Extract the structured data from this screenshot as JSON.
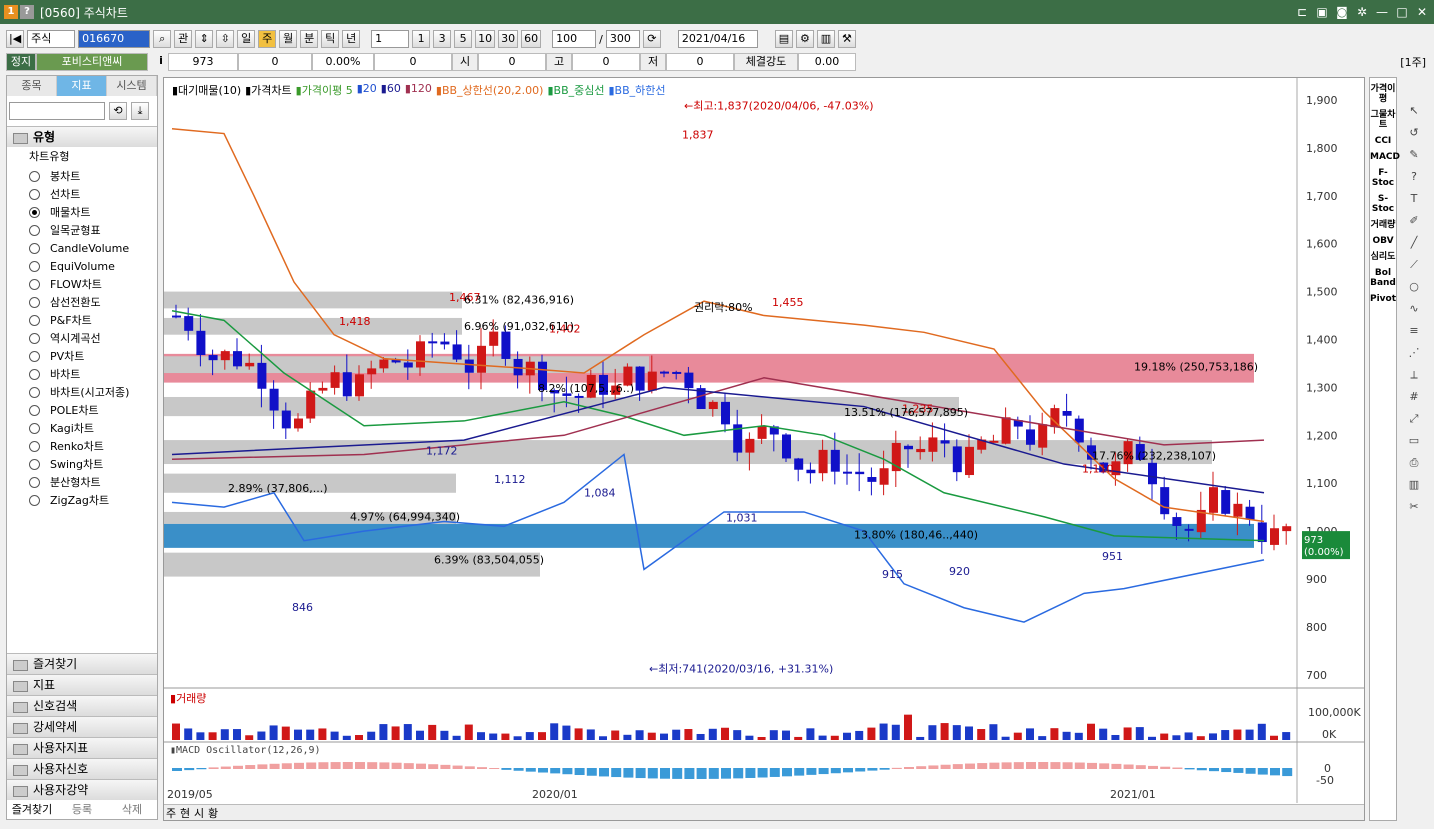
{
  "window": {
    "badge": "1",
    "help": "?",
    "title": "[0560] 주식차트"
  },
  "toolbar": {
    "market": "주식",
    "code": "016670",
    "gwan": "관",
    "periods": [
      "일",
      "주",
      "월",
      "분",
      "틱",
      "년"
    ],
    "period_selected": "주",
    "interval": "1",
    "quick": [
      "1",
      "3",
      "5",
      "10",
      "30",
      "60"
    ],
    "count": "100",
    "total": "300",
    "date": "2021/04/16"
  },
  "quote": {
    "status": "정지",
    "name": "포비스티앤씨",
    "info": "i",
    "price": "973",
    "change": "0",
    "rate": "0.00%",
    "vol": "0",
    "open_l": "시",
    "open": "0",
    "high_l": "고",
    "high": "0",
    "low_l": "저",
    "low": "0",
    "str_l": "체결강도",
    "str": "0.00",
    "unit": "[1주]"
  },
  "left": {
    "tabs": [
      "종목",
      "지표",
      "시스템"
    ],
    "tab_on": "지표",
    "group": "유형",
    "subgroup": "차트유형",
    "types": [
      "봉차트",
      "선차트",
      "매물차트",
      "일목균형표",
      "CandleVolume",
      "EquiVolume",
      "FLOW차트",
      "삼선전환도",
      "P&F차트",
      "역시계곡선",
      "PV차트",
      "바차트",
      "바차트(시고저종)",
      "POLE차트",
      "Kagi차트",
      "Renko차트",
      "Swing차트",
      "분산형차트",
      "ZigZag차트"
    ],
    "selected": "매물차트",
    "groups": [
      "즐겨찾기",
      "지표",
      "신호검색",
      "강세약세",
      "사용자지표",
      "사용자신호",
      "사용자강약"
    ],
    "bottom": [
      "즐겨찾기",
      "등록",
      "삭제"
    ]
  },
  "legend": {
    "items": [
      "대기매물(10)",
      "가격차트",
      "가격이평 5",
      "20",
      "60",
      "120",
      "BB_상한선(20,2.00)",
      "BB_중심선",
      "BB_하한선"
    ],
    "colors": [
      "#000",
      "#000",
      "#3a9a2a",
      "#2050d0",
      "#1a1a90",
      "#a03050",
      "#e06a20",
      "#1a9a40",
      "#2a6ae0"
    ]
  },
  "annotations": {
    "high": "←최고:1,837(2020/04/06, -47.03%)",
    "low": "←최저:741(2020/03/16, +31.31%)",
    "rights": "권리락:80%",
    "price_tag": "973",
    "price_tag2": "(0.00%)",
    "points": [
      "1,837",
      "1,467",
      "1,418",
      "1,402",
      "1,455",
      "1,235",
      "1,110",
      "1,172",
      "1,112",
      "1,084",
      "1,031",
      "915",
      "920",
      "951",
      "846"
    ],
    "zones": [
      "6.31% (82,436,916)",
      "6.96% (91,032,611)",
      "19.18% (250,753,186)",
      "8.2% (107,5..,6..)",
      "13.51% (176,577,895)",
      "17.76% (232,238,107)",
      "2.89% (37,806,...)",
      "4.97% (64,994,340)",
      "6.39% (83,504,055)",
      "13.80% (180,46..,440)"
    ]
  },
  "yaxis": [
    "1,900",
    "1,800",
    "1,700",
    "1,600",
    "1,500",
    "1,400",
    "1,300",
    "1,200",
    "1,100",
    "1,000",
    "900",
    "800",
    "700"
  ],
  "volume": {
    "title": "거래량",
    "axis": [
      "100,000K",
      "0K"
    ]
  },
  "macd": {
    "title": "MACD Oscillator(12,26,9)",
    "axis": [
      "0",
      "-50"
    ]
  },
  "xaxis": [
    "2019/05",
    "2020/01",
    "2021/01"
  ],
  "bottombar": [
    "주",
    "현",
    "시",
    "황"
  ],
  "righttools": [
    "가격이평",
    "그물차트",
    "CCI",
    "MACD",
    "F-Stoc",
    "S-Stoc",
    "거래량",
    "OBV",
    "심리도",
    "Bol Band",
    "Pivot"
  ]
}
